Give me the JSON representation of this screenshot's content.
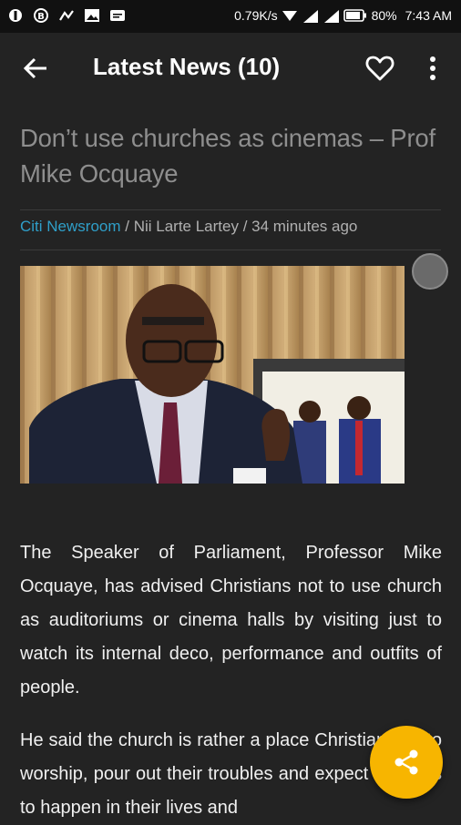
{
  "status_bar": {
    "speed": "0.79K/s",
    "battery": "80%",
    "time": "7:43 AM"
  },
  "app_bar": {
    "title": "Latest News (10)"
  },
  "article": {
    "title": "Don’t use churches as cinemas – Prof Mike Ocquaye",
    "source": "Citi Newsroom",
    "byline_rest": " / Nii Larte Lartey / 34 minutes ago",
    "paragraphs": [
      "The Speaker of Parliament, Professor Mike Ocquaye, has advised Christians not to use church as auditoriums or cinema halls by visiting just to watch its internal deco, performance and outfits of people.",
      "He said the church is rather a place Christians go to worship, pour out their troubles and expect miracles to happen in their lives and"
    ]
  },
  "colors": {
    "background": "#232323",
    "link": "#2f9fc9",
    "fab": "#f7b500"
  },
  "icons": [
    "back-arrow-icon",
    "heart-icon",
    "more-vert-icon",
    "share-icon"
  ]
}
